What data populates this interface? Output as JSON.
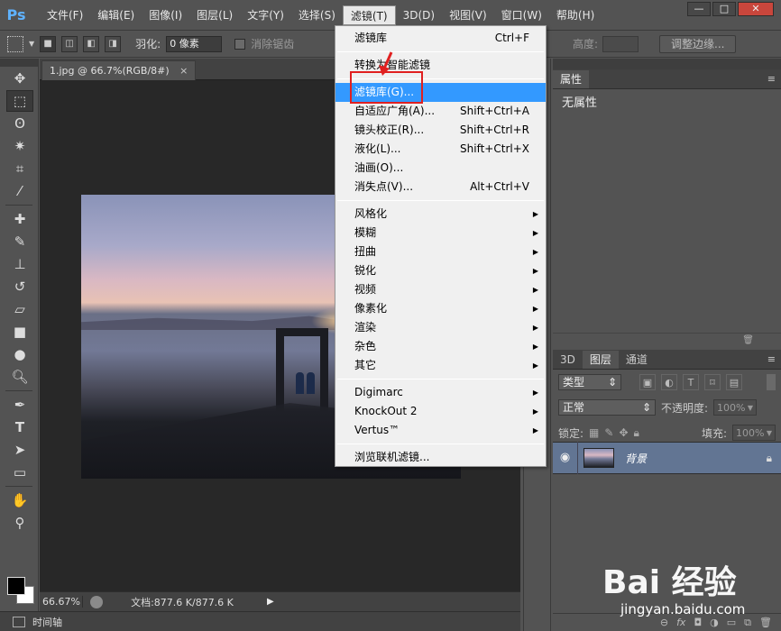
{
  "app": {
    "logo": "Ps"
  },
  "menubar": {
    "items": [
      "文件(F)",
      "编辑(E)",
      "图像(I)",
      "图层(L)",
      "文字(Y)",
      "选择(S)",
      "滤镜(T)",
      "3D(D)",
      "视图(V)",
      "窗口(W)",
      "帮助(H)"
    ],
    "window_controls": [
      "—",
      "□",
      "✕"
    ]
  },
  "options": {
    "feather_label": "羽化:",
    "feather_value": "0 像素",
    "antialias_label": "消除锯齿",
    "height_label": "高度:",
    "refine_edge": "调整边缘..."
  },
  "document": {
    "tab_title": "1.jpg @ 66.7%(RGB/8#)",
    "tab_close": "×",
    "zoom": "66.67%",
    "doc_info": "文档:877.6 K/877.6 K"
  },
  "timeline": {
    "label": "时间轴"
  },
  "properties": {
    "tab": "属性",
    "body": "无属性"
  },
  "layers": {
    "tabs": [
      "3D",
      "图层",
      "通道"
    ],
    "filter_kind": "类型",
    "blend_mode": "正常",
    "opacity_label": "不透明度:",
    "opacity_value": "100%",
    "lock_label": "锁定:",
    "fill_label": "填充:",
    "fill_value": "100%",
    "layer_name": "背景"
  },
  "filter_menu": {
    "top": [
      {
        "label": "滤镜库",
        "shortcut": "Ctrl+F"
      }
    ],
    "convert": "转换为智能滤镜",
    "group1": [
      {
        "label": "滤镜库(G)...",
        "shortcut": ""
      },
      {
        "label": "自适应广角(A)...",
        "shortcut": "Shift+Ctrl+A"
      },
      {
        "label": "镜头校正(R)...",
        "shortcut": "Shift+Ctrl+R"
      },
      {
        "label": "液化(L)...",
        "shortcut": "Shift+Ctrl+X"
      },
      {
        "label": "油画(O)...",
        "shortcut": ""
      },
      {
        "label": "消失点(V)...",
        "shortcut": "Alt+Ctrl+V"
      }
    ],
    "group2": [
      "风格化",
      "模糊",
      "扭曲",
      "锐化",
      "视频",
      "像素化",
      "渲染",
      "杂色",
      "其它"
    ],
    "group3": [
      "Digimarc",
      "KnockOut 2",
      "Vertus™"
    ],
    "browse": "浏览联机滤镜..."
  },
  "watermark": {
    "brand": "Bai 经验",
    "url": "jingyan.baidu.com"
  }
}
